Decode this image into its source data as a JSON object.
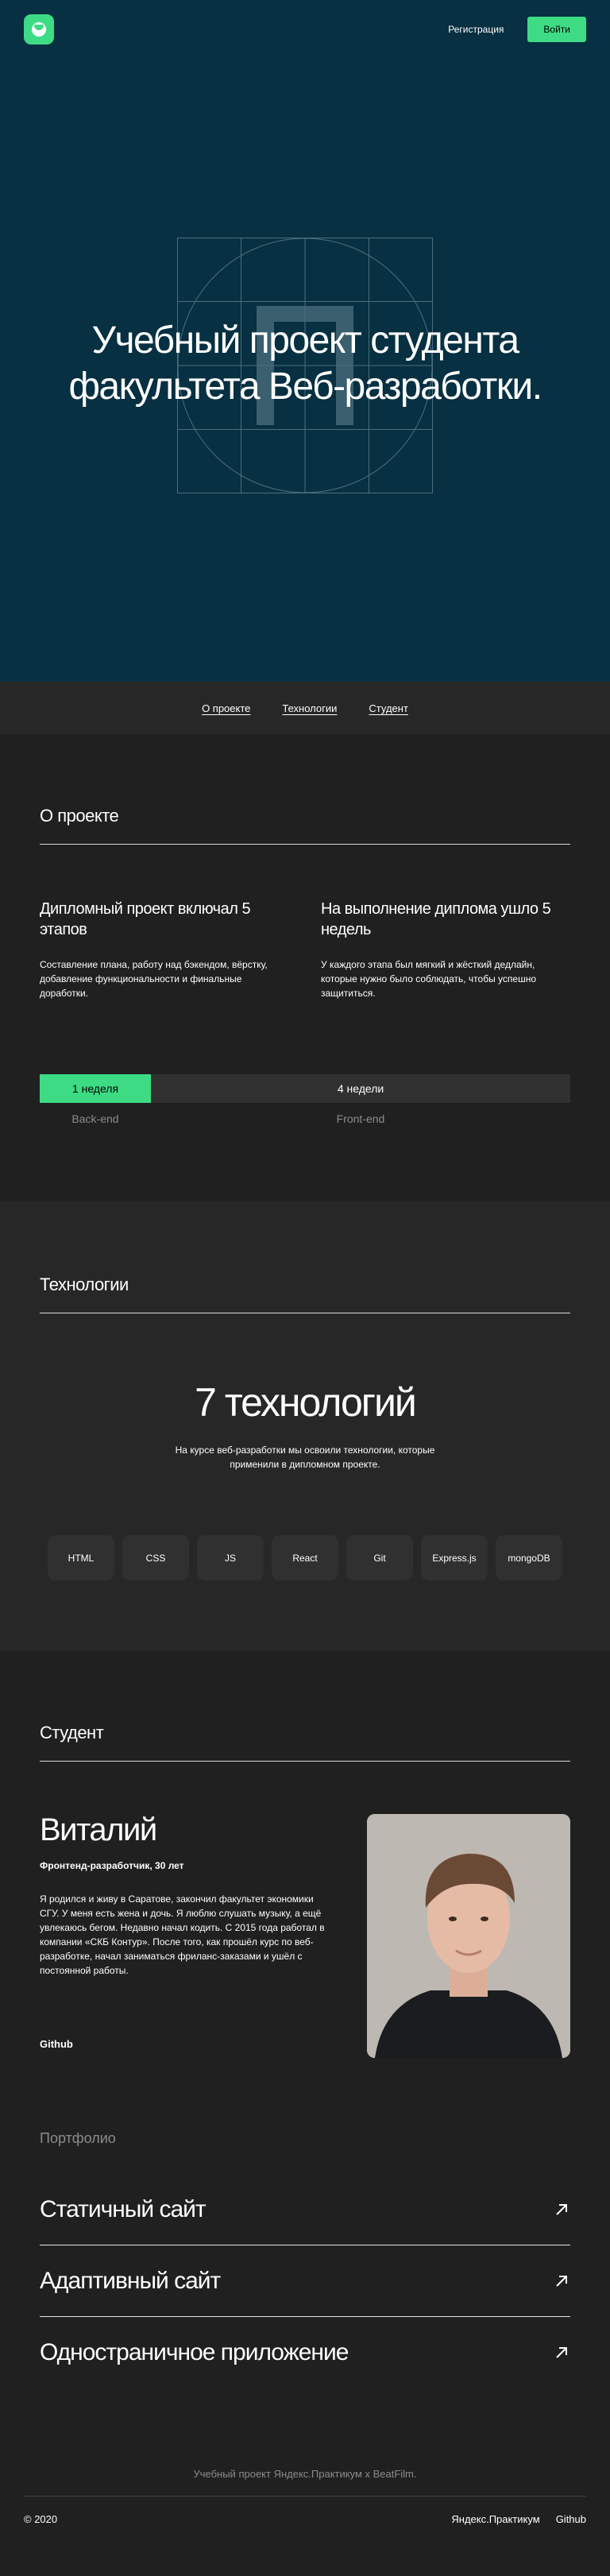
{
  "header": {
    "register": "Регистрация",
    "login": "Войти"
  },
  "hero": {
    "title_line1": "Учебный проект студента",
    "title_line2": "факультета Веб-разработки."
  },
  "nav": {
    "about": "О проекте",
    "tech": "Технологии",
    "student": "Студент"
  },
  "about": {
    "title": "О проекте",
    "col1_title": "Дипломный проект включал 5 этапов",
    "col1_text": "Составление плана, работу над бэкендом, вёрстку, добавление функциональности и финальные доработки.",
    "col2_title": "На выполнение диплома ушло 5 недель",
    "col2_text": "У каждого этапа был мягкий и жёсткий дедлайн, которые нужно было соблюдать, чтобы успешно защититься.",
    "timeline": {
      "backend_weeks": "1 неделя",
      "frontend_weeks": "4 недели",
      "backend_label": "Back-end",
      "frontend_label": "Front-end"
    }
  },
  "tech": {
    "title": "Технологии",
    "big": "7 технологий",
    "desc": "На курсе веб-разработки мы освоили технологии, которые применили в дипломном проекте.",
    "items": [
      "HTML",
      "CSS",
      "JS",
      "React",
      "Git",
      "Express.js",
      "mongoDB"
    ]
  },
  "student": {
    "title": "Студент",
    "name": "Виталий",
    "role": "Фронтенд-разработчик, 30 лет",
    "bio": "Я родился и живу в Саратове, закончил факультет экономики СГУ. У меня есть жена и дочь. Я люблю слушать музыку, а ещё увлекаюсь бегом. Недавно начал кодить. С 2015 года работал в компании «СКБ Контур». После того, как прошёл курс по веб-разработке, начал заниматься фриланс-заказами и ушёл с постоянной работы.",
    "github": "Github"
  },
  "portfolio": {
    "title": "Портфолио",
    "items": [
      "Статичный сайт",
      "Адаптивный сайт",
      "Одностраничное приложение"
    ]
  },
  "footer": {
    "note": "Учебный проект Яндекс.Практикум х BeatFilm.",
    "copyright": "© 2020",
    "links": [
      "Яндекс.Практикум",
      "Github"
    ]
  },
  "colors": {
    "accent": "#3ddc84",
    "hero_bg": "#073042",
    "page_bg": "#202020"
  }
}
